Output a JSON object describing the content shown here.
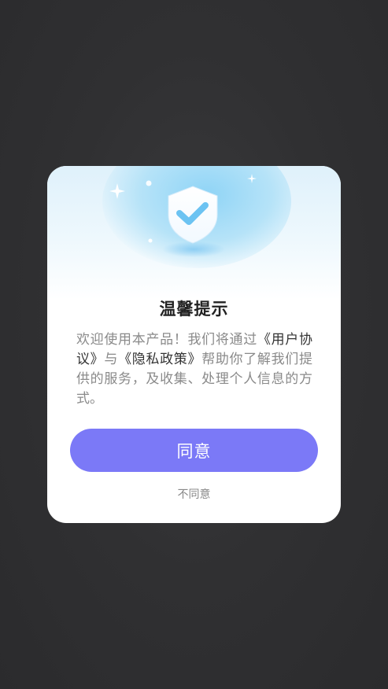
{
  "dialog": {
    "icon": "shield-check-icon",
    "title": "温馨提示",
    "message": {
      "prefix": "欢迎使用本产品！我们将通过",
      "user_agreement": "《用户协议》",
      "connector": "与",
      "privacy_policy": "《隐私政策》",
      "suffix": "帮助你了解我们提供的服务，及收集、处理个人信息的方式。"
    },
    "agree_label": "同意",
    "disagree_label": "不同意"
  },
  "colors": {
    "primary": "#7b79f7",
    "backdrop": "#2e2e30",
    "shield_blue": "#6cc3f2"
  }
}
